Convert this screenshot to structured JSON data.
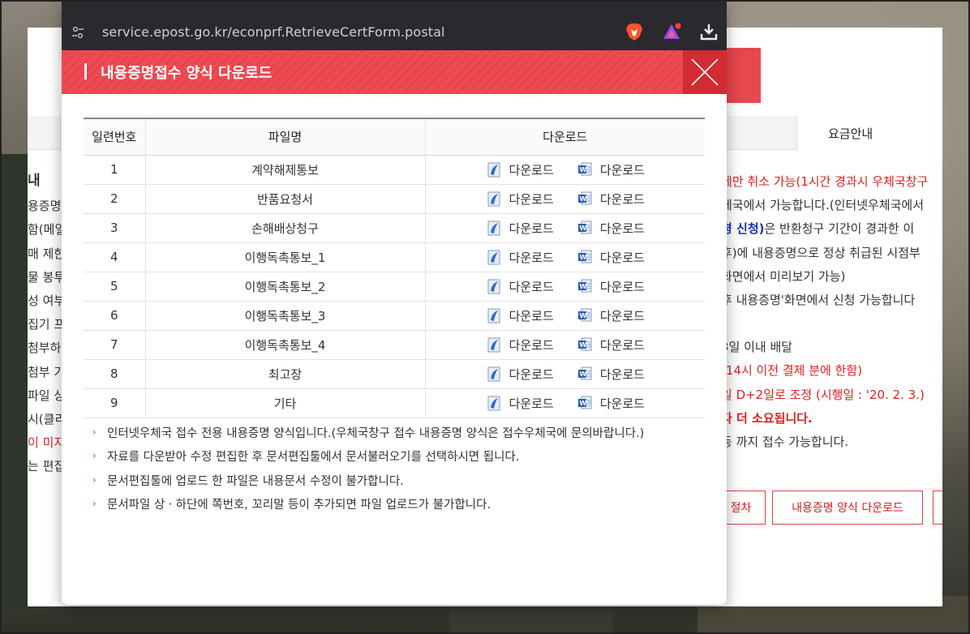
{
  "browser": {
    "url": "service.epost.go.kr/econprf.RetrieveCertForm.postal",
    "site_icon": "site-settings-icon",
    "extensions": [
      "brave-shield-icon",
      "alert-triangle-icon",
      "download-icon"
    ]
  },
  "popup": {
    "title": "내용증명접수 양식 다운로드",
    "close_icon": "close-icon",
    "table": {
      "headers": [
        "일련번호",
        "파일명",
        "다운로드"
      ],
      "rows": [
        {
          "no": "1",
          "name": "계약해제통보",
          "dl1": "다운로드",
          "dl2": "다운로드"
        },
        {
          "no": "2",
          "name": "반품요청서",
          "dl1": "다운로드",
          "dl2": "다운로드"
        },
        {
          "no": "3",
          "name": "손해배상청구",
          "dl1": "다운로드",
          "dl2": "다운로드"
        },
        {
          "no": "4",
          "name": "이행독촉통보_1",
          "dl1": "다운로드",
          "dl2": "다운로드"
        },
        {
          "no": "5",
          "name": "이행독촉통보_2",
          "dl1": "다운로드",
          "dl2": "다운로드"
        },
        {
          "no": "6",
          "name": "이행독촉통보_3",
          "dl1": "다운로드",
          "dl2": "다운로드"
        },
        {
          "no": "7",
          "name": "이행독촉통보_4",
          "dl1": "다운로드",
          "dl2": "다운로드"
        },
        {
          "no": "8",
          "name": "최고장",
          "dl1": "다운로드",
          "dl2": "다운로드"
        },
        {
          "no": "9",
          "name": "기타",
          "dl1": "다운로드",
          "dl2": "다운로드"
        }
      ]
    },
    "notes": [
      "인터넷우체국 접수 전용 내용증명 양식입니다.(우체국창구 접수 내용증명 양식은 접수우체국에 문의바랍니다.)",
      "자료를 다운받아 수정 편집한 후 문서편집툴에서 문서불러오기를 선택하시면 됩니다.",
      "문서편집툴에 업로드 한 파일은 내용문서 수정이 불가합니다.",
      "문서파일 상ㆍ하단에 쪽번호, 꼬리말 등이 추가되면 파일 업로드가 불가합니다."
    ]
  },
  "background_page": {
    "fee_tab": "요금안내",
    "left_lines": [
      "내",
      "용증명",
      "함(메일",
      "매 제한",
      "물 봉투",
      "성 여부",
      "집기 프",
      "첨부하",
      "첨부 가",
      "파일 상",
      "시(클리",
      "이 미지",
      "는 편집"
    ],
    "right_lines": [
      {
        "t": "에만 취소 가능(1시간 경과시 우체국창구",
        "c": "red"
      },
      {
        "t": "체국에서 가능합니다.(인터넷우체국에서",
        "c": ""
      },
      {
        "t": "",
        "c": "mixed"
      },
      {
        "t": "후)에 내용증명으로 정상 취급된 시점부",
        "c": ""
      },
      {
        "t": "화면에서 미리보기 가능)",
        "c": ""
      },
      {
        "t": "후 내용증명'화면에서 신청 가능합니다",
        "c": ""
      },
      {
        "t": "",
        "c": "gap"
      },
      {
        "t": "3일 이내 배달",
        "c": ""
      },
      {
        "t": "(14시 이전 결제 분에 한함)",
        "c": "red"
      },
      {
        "t": "일 D+2일로 조정 (시행일 : '20. 2. 3.)",
        "c": "red"
      },
      {
        "t": "다 더 소요됩니다.",
        "c": "red"
      },
      {
        "t": "등 까지 접수 가능합니다.",
        "c": ""
      }
    ],
    "right_mixed": {
      "blue": "령 신청)",
      "rest": "은 반환청구 기간이 경과한 이"
    },
    "buttons": [
      "절차",
      "내용증명 양식 다운로드"
    ]
  }
}
